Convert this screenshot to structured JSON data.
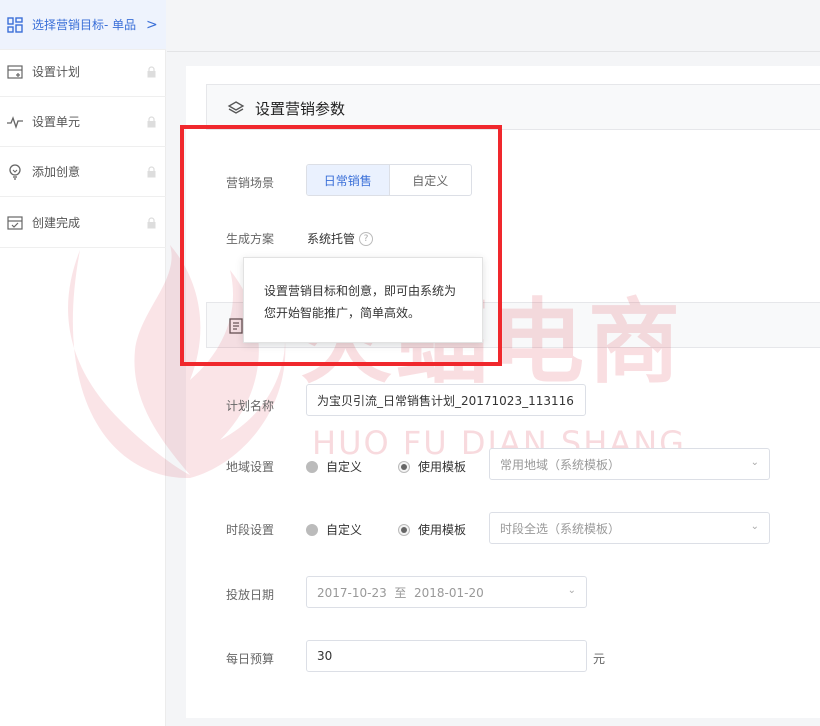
{
  "sidebar": {
    "items": [
      {
        "label": "选择营销目标- 单品",
        "icon": "grid-icon",
        "active": true
      },
      {
        "label": "设置计划",
        "icon": "calendar-plus-icon",
        "locked": true
      },
      {
        "label": "设置单元",
        "icon": "pulse-icon",
        "locked": true
      },
      {
        "label": "添加创意",
        "icon": "lightbulb-icon",
        "locked": true
      },
      {
        "label": "创建完成",
        "icon": "calendar-check-icon",
        "locked": true
      }
    ],
    "chevron": ">"
  },
  "section": {
    "title": "设置营销参数"
  },
  "form": {
    "scene": {
      "label": "营销场景",
      "options": [
        "日常销售",
        "自定义"
      ],
      "selected": "日常销售"
    },
    "plan_mode": {
      "label": "生成方案",
      "value": "系统托管",
      "help": "?"
    },
    "tooltip": "设置营销目标和创意，即可由系统为您开始智能推广，简单高效。",
    "plan_name": {
      "label": "计划名称",
      "value": "为宝贝引流_日常销售计划_20171023_113116"
    },
    "region": {
      "label": "地域设置",
      "opt_custom": "自定义",
      "opt_template": "使用模板",
      "select": "常用地域（系统模板）"
    },
    "time": {
      "label": "时段设置",
      "opt_custom": "自定义",
      "opt_template": "使用模板",
      "select": "时段全选（系统模板）"
    },
    "dates": {
      "label": "投放日期",
      "value": "2017-10-23  至  2018-01-20"
    },
    "budget": {
      "label": "每日预算",
      "value": "30",
      "unit": "元"
    }
  },
  "watermark": {
    "text": "火蝠电商",
    "sub": "HUO FU DIAN SHANG"
  },
  "colors": {
    "accent": "#3a6fd8",
    "highlight_box": "#f0282d",
    "watermark": "#da3246"
  }
}
